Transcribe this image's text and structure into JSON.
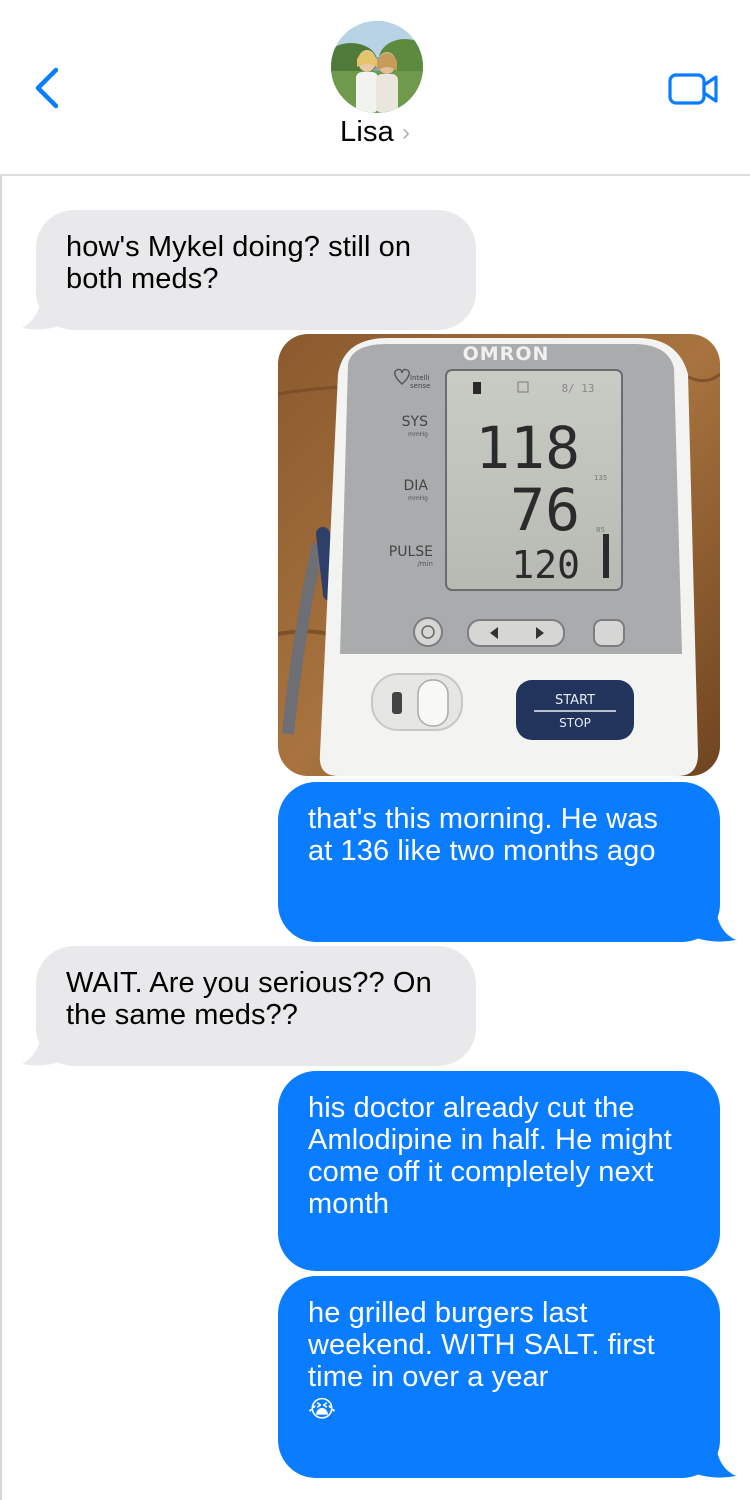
{
  "header": {
    "contact_name": "Lisa",
    "chevron": "›",
    "back_icon": "chevron-left-icon",
    "video_icon": "video-camera-icon",
    "accent_color": "#0a7cff"
  },
  "messages": [
    {
      "direction": "incoming",
      "text": "how's Mykel doing? still on both meds?"
    },
    {
      "direction": "outgoing",
      "type": "image",
      "image_alt": "Omron blood pressure monitor"
    },
    {
      "direction": "outgoing",
      "text": "that's this morning. He was at 136 like two months ago"
    },
    {
      "direction": "incoming",
      "text": "WAIT. Are you serious?? On the same meds??"
    },
    {
      "direction": "outgoing",
      "text": "his doctor already cut the Amlodipine in half. He might come off it completely next month"
    },
    {
      "direction": "outgoing",
      "text": "he grilled burgers last weekend. WITH SALT. first time in over a year",
      "emoji": "😭"
    }
  ],
  "monitor": {
    "brand": "OMRON",
    "intellisense_line1": "Intelli",
    "intellisense_line2": "sense",
    "sys_label": "SYS",
    "dia_label": "DIA",
    "pulse_label": "PULSE",
    "mmhg": "mmHg",
    "per_min": "/min",
    "date": "8/ 13",
    "sys_value": "118",
    "dia_value": "76",
    "pulse_value": "120",
    "scale_135": "135",
    "scale_85": "85",
    "start_label": "START",
    "stop_label": "STOP"
  }
}
